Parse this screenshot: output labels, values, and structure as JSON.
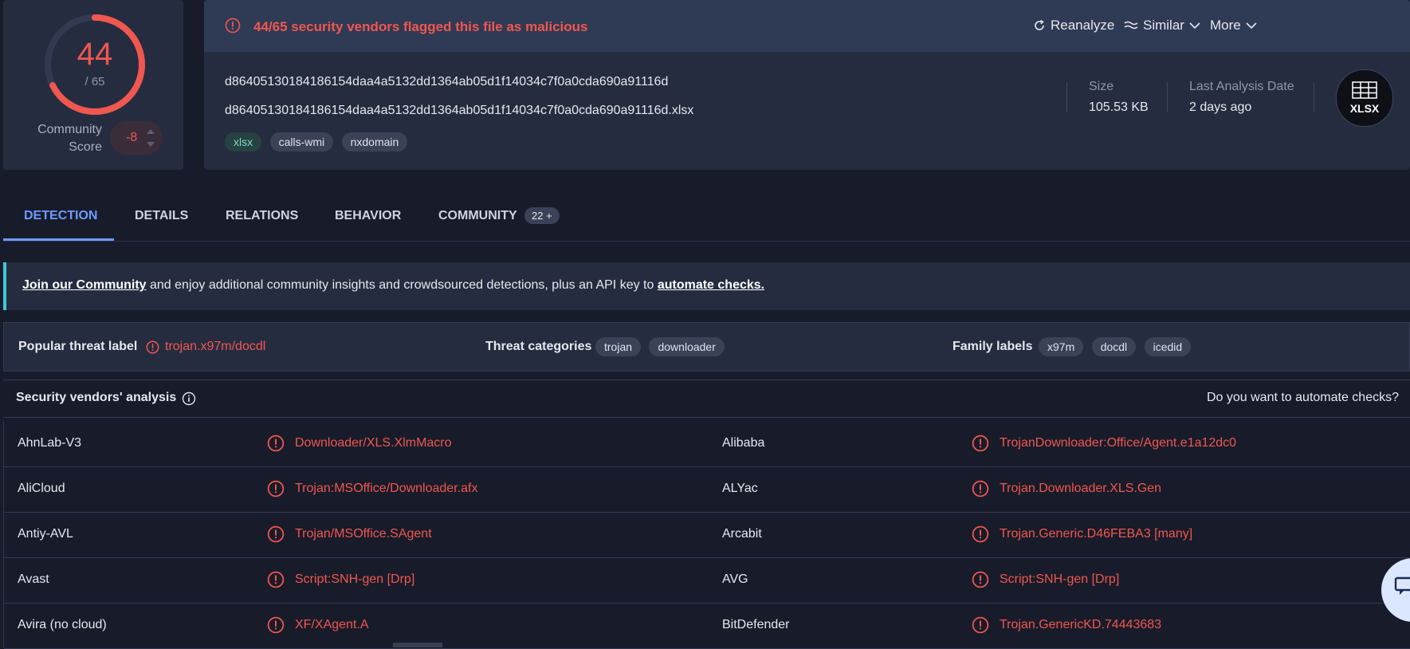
{
  "score": {
    "detections": "44",
    "total": "/ 65",
    "fraction": 0.677
  },
  "community": {
    "label_line1": "Community",
    "label_line2": "Score",
    "value": "-8"
  },
  "alert": {
    "text": "44/65 security vendors flagged this file as malicious"
  },
  "header_actions": {
    "reanalyze": "Reanalyze",
    "similar": "Similar",
    "more": "More"
  },
  "file": {
    "hash": "d86405130184186154daa4a5132dd1364ab05d1f14034c7f0a0cda690a91116d",
    "name": "d86405130184186154daa4a5132dd1364ab05d1f14034c7f0a0cda690a91116d.xlsx",
    "tags": [
      "xlsx",
      "calls-wmi",
      "nxdomain"
    ],
    "size_label": "Size",
    "size_value": "105.53 KB",
    "date_label": "Last Analysis Date",
    "date_value": "2 days ago",
    "type_badge": "XLSX"
  },
  "tabs": [
    {
      "label": "DETECTION"
    },
    {
      "label": "DETAILS"
    },
    {
      "label": "RELATIONS"
    },
    {
      "label": "BEHAVIOR"
    },
    {
      "label": "COMMUNITY"
    }
  ],
  "community_count": "22 +",
  "banner": {
    "link1": "Join our Community",
    "middle": " and enjoy additional community insights and crowdsourced detections, plus an API key to ",
    "link2": "automate checks."
  },
  "threat": {
    "popular_label": "Popular threat label",
    "popular_value": "trojan.x97m/docdl",
    "categories_label": "Threat categories",
    "categories": [
      "trojan",
      "downloader"
    ],
    "family_label": "Family labels",
    "families": [
      "x97m",
      "docdl",
      "icedid"
    ]
  },
  "analysis": {
    "title": "Security vendors' analysis",
    "automate_question": "Do you want to automate checks?"
  },
  "vendors": [
    {
      "left_name": "AhnLab-V3",
      "left_result": "Downloader/XLS.XlmMacro",
      "right_name": "Alibaba",
      "right_result": "TrojanDownloader:Office/Agent.e1a12dc0"
    },
    {
      "left_name": "AliCloud",
      "left_result": "Trojan:MSOffice/Downloader.afx",
      "right_name": "ALYac",
      "right_result": "Trojan.Downloader.XLS.Gen"
    },
    {
      "left_name": "Antiy-AVL",
      "left_result": "Trojan/MSOffice.SAgent",
      "right_name": "Arcabit",
      "right_result": "Trojan.Generic.D46FEBA3 [many]"
    },
    {
      "left_name": "Avast",
      "left_result": "Script:SNH-gen [Drp]",
      "right_name": "AVG",
      "right_result": "Script:SNH-gen [Drp]"
    },
    {
      "left_name": "Avira (no cloud)",
      "left_result": "XF/XAgent.A",
      "right_name": "BitDefender",
      "right_result": "Trojan.GenericKD.74443683"
    }
  ],
  "colors": {
    "malicious": "#f0574f",
    "accent": "#6f9bff",
    "banner_accent": "#3ec8d8"
  },
  "icons": {
    "alert": "alert-circle-icon",
    "reanalyze": "refresh-icon",
    "similar": "similar-wave-icon",
    "more": "chevron-down-icon",
    "info": "info-icon"
  }
}
